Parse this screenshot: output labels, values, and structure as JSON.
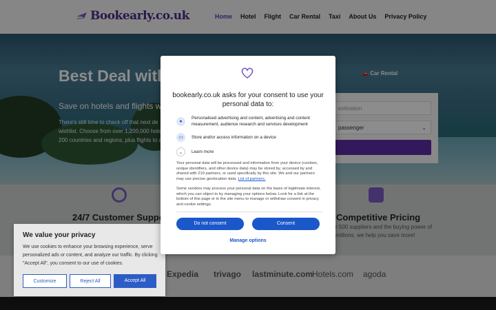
{
  "header": {
    "logo_text": "Bookearly.co.uk",
    "nav": [
      "Home",
      "Hotel",
      "Flight",
      "Car Rental",
      "Taxi",
      "About Us",
      "Privacy Policy"
    ],
    "active_nav": "Home"
  },
  "hero": {
    "title": "Best Deal with",
    "subtitle": "Save on hotels and flights w",
    "description_lines": [
      "There's still time to check off that next de",
      "wishlist. Choose from over 1,200,000 hote",
      "200 countries and regions, plus flights to a"
    ],
    "tab_car_rental": "Car Rental",
    "destination_placeholder": "estination",
    "passenger_text": "passenger"
  },
  "features": {
    "support_title": "24/7 Customer Suppo",
    "pricing_title": "Competitive Pricing",
    "pricing_text_lines": [
      "r 500 suppliers and the buying power of",
      "millions, we help you save more!"
    ]
  },
  "brands": [
    "Expedia",
    "trivago",
    "lastminute.com",
    "Hotels.com",
    "agoda"
  ],
  "cookie_banner": {
    "title": "We value your privacy",
    "text": "We use cookies to enhance your browsing experience, serve personalized ads or content, and analyze our traffic. By clicking \"Accept All\", you consent to our use of cookies.",
    "customize": "Customize",
    "reject_all": "Reject All",
    "accept_all": "Accept All"
  },
  "consent_modal": {
    "title": "bookearly.co.uk asks for your consent to use your personal data to:",
    "purposes": [
      "Personalised advertising and content, advertising and content measurement, audience research and services development",
      "Store and/or access information on a device",
      "Learn more"
    ],
    "paragraph1": "Your personal data will be processed and information from your device (cookies, unique identifiers, and other device data) may be stored by, accessed by and shared with 210 partners, or used specifically by this site. We and our partners may use precise geolocation data.",
    "partners_link": "List of partners.",
    "paragraph2": "Some vendors may process your personal data on the basis of legitimate interest, which you can object to by managing your options below. Look for a link at the bottom of this page or in the site menu to manage or withdraw consent in privacy and cookie settings.",
    "do_not_consent": "Do not consent",
    "consent": "Consent",
    "manage_options": "Manage options"
  },
  "colors": {
    "brand_purple": "#5e2fa6",
    "consent_blue": "#1a57c9",
    "cookie_blue": "#2c5cc5"
  }
}
